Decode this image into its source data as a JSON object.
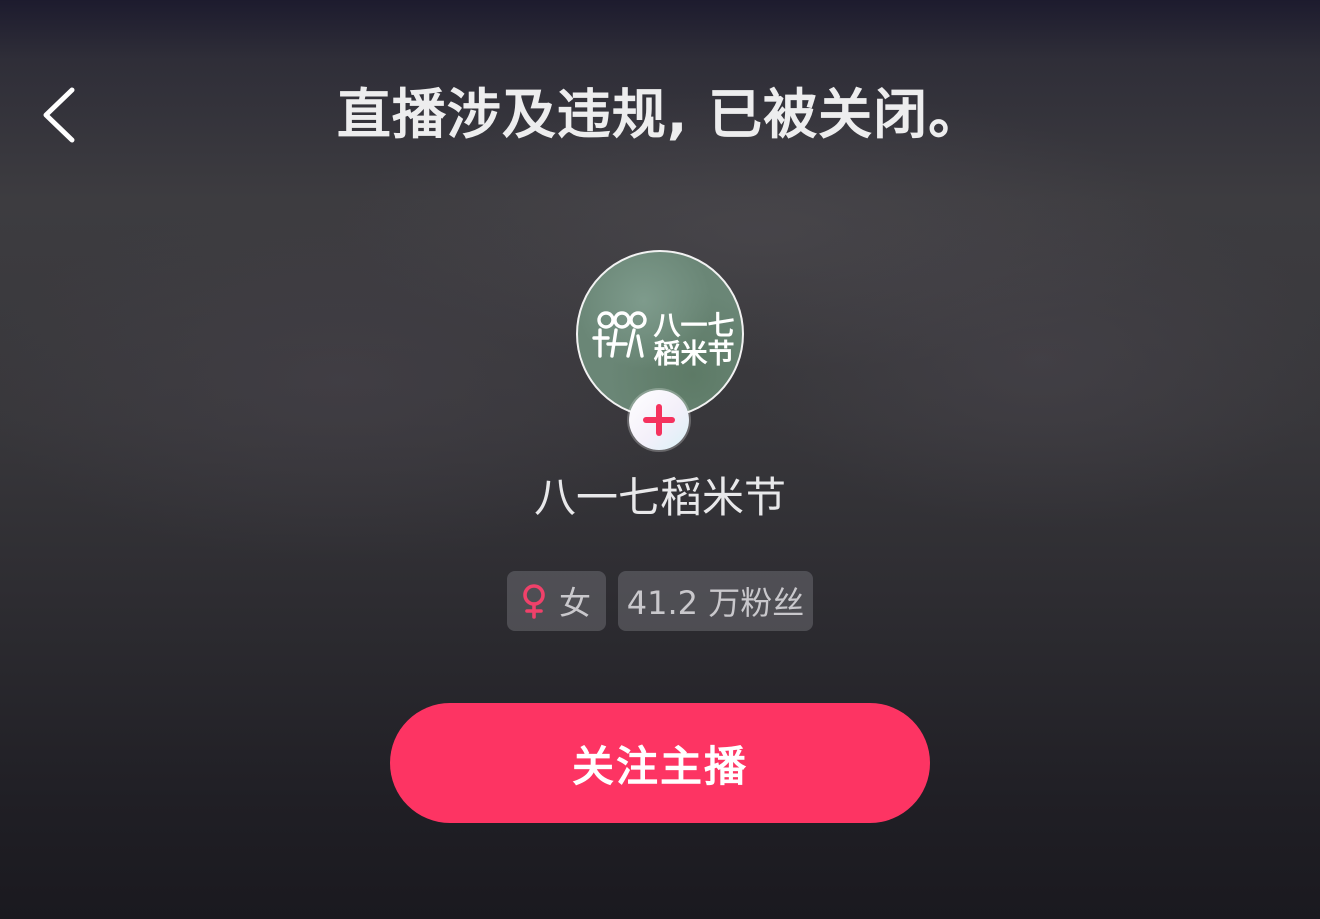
{
  "header": {
    "back_icon": "chevron-left-icon",
    "notice": "直播涉及违规, 已被关闭。"
  },
  "streamer": {
    "avatar_text_top": "八一七",
    "avatar_text_bottom": "稻米节",
    "name": "八一七稻米节",
    "follow_icon": "plus-icon",
    "gender_icon": "female-icon",
    "gender": "女",
    "fans": "41.2 万粉丝"
  },
  "actions": {
    "follow_label": "关注主播"
  },
  "colors": {
    "accent": "#fd3463",
    "gender_icon": "#f0416a"
  }
}
